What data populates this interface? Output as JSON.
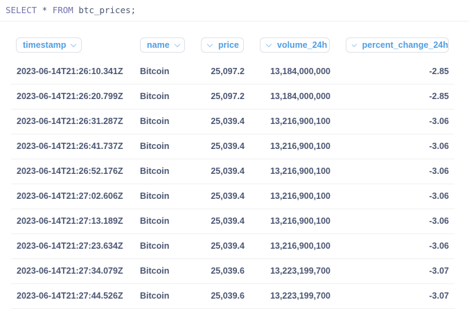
{
  "editor": {
    "kw_select": "SELECT",
    "star": " * ",
    "kw_from": "FROM",
    "rest": " btc_prices;"
  },
  "columns": [
    {
      "key": "timestamp",
      "label": "timestamp"
    },
    {
      "key": "name",
      "label": "name"
    },
    {
      "key": "price",
      "label": "price"
    },
    {
      "key": "volume_24h",
      "label": "volume_24h"
    },
    {
      "key": "percent_change_24h",
      "label": "percent_change_24h"
    }
  ],
  "rows": [
    {
      "timestamp": "2023-06-14T21:26:10.341Z",
      "name": "Bitcoin",
      "price": "25,097.2",
      "volume_24h": "13,184,000,000",
      "percent_change_24h": "-2.85"
    },
    {
      "timestamp": "2023-06-14T21:26:20.799Z",
      "name": "Bitcoin",
      "price": "25,097.2",
      "volume_24h": "13,184,000,000",
      "percent_change_24h": "-2.85"
    },
    {
      "timestamp": "2023-06-14T21:26:31.287Z",
      "name": "Bitcoin",
      "price": "25,039.4",
      "volume_24h": "13,216,900,100",
      "percent_change_24h": "-3.06"
    },
    {
      "timestamp": "2023-06-14T21:26:41.737Z",
      "name": "Bitcoin",
      "price": "25,039.4",
      "volume_24h": "13,216,900,100",
      "percent_change_24h": "-3.06"
    },
    {
      "timestamp": "2023-06-14T21:26:52.176Z",
      "name": "Bitcoin",
      "price": "25,039.4",
      "volume_24h": "13,216,900,100",
      "percent_change_24h": "-3.06"
    },
    {
      "timestamp": "2023-06-14T21:27:02.606Z",
      "name": "Bitcoin",
      "price": "25,039.4",
      "volume_24h": "13,216,900,100",
      "percent_change_24h": "-3.06"
    },
    {
      "timestamp": "2023-06-14T21:27:13.189Z",
      "name": "Bitcoin",
      "price": "25,039.4",
      "volume_24h": "13,216,900,100",
      "percent_change_24h": "-3.06"
    },
    {
      "timestamp": "2023-06-14T21:27:23.634Z",
      "name": "Bitcoin",
      "price": "25,039.4",
      "volume_24h": "13,216,900,100",
      "percent_change_24h": "-3.06"
    },
    {
      "timestamp": "2023-06-14T21:27:34.079Z",
      "name": "Bitcoin",
      "price": "25,039.6",
      "volume_24h": "13,223,199,700",
      "percent_change_24h": "-3.07"
    },
    {
      "timestamp": "2023-06-14T21:27:44.526Z",
      "name": "Bitcoin",
      "price": "25,039.6",
      "volume_24h": "13,223,199,700",
      "percent_change_24h": "-3.07"
    }
  ],
  "colors": {
    "header_text": "#509ee3",
    "cell_text": "#4c5773",
    "keyword": "#7172ad"
  },
  "icons": {
    "column_menu": "chevron-down-icon"
  }
}
